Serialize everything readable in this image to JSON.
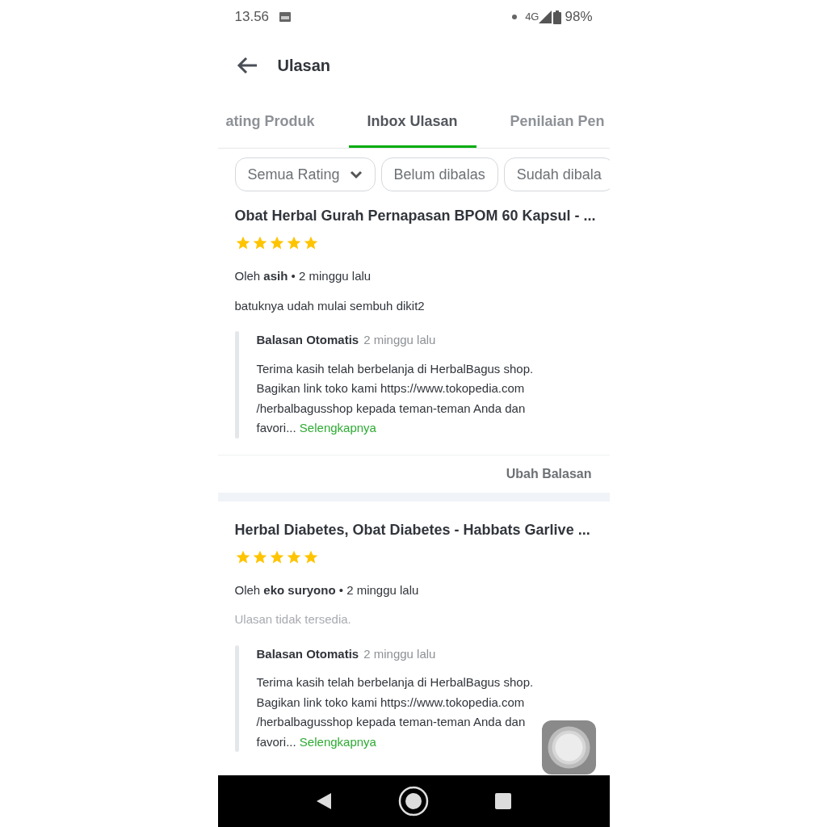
{
  "status_bar": {
    "time": "13.56",
    "network": "4G",
    "battery": "98%"
  },
  "header": {
    "title": "Ulasan"
  },
  "tabs": [
    {
      "label": "ating Produk",
      "selected": false
    },
    {
      "label": "Inbox Ulasan",
      "selected": true
    },
    {
      "label": "Penilaian Pen",
      "selected": false
    }
  ],
  "filters": [
    {
      "label": "Semua Rating",
      "dropdown": true
    },
    {
      "label": "Belum dibalas",
      "dropdown": false
    },
    {
      "label": "Sudah dibala",
      "dropdown": false
    }
  ],
  "reviews": [
    {
      "product": "Obat Herbal Gurah Pernapasan BPOM 60 Kapsul - ...",
      "stars": 5,
      "by": "Oleh",
      "reviewer": "asih",
      "separator": "•",
      "time": "2 minggu lalu",
      "text": "batuknya udah mulai sembuh dikit2",
      "available": true,
      "reply": {
        "author": "Balasan Otomatis",
        "time": "2 minggu lalu",
        "lines": [
          "Terima kasih telah berbelanja di HerbalBagus shop.",
          "Bagikan link toko kami https://www.tokopedia.com",
          "/herbalbagusshop kepada teman-teman Anda dan",
          "favori..."
        ],
        "more": "Selengkapnya"
      },
      "action": "Ubah Balasan"
    },
    {
      "product": "Herbal Diabetes, Obat Diabetes - Habbats Garlive ...",
      "stars": 5,
      "by": "Oleh",
      "reviewer": "eko suryono",
      "separator": "•",
      "time": "2 minggu lalu",
      "text": "Ulasan tidak tersedia.",
      "available": false,
      "reply": {
        "author": "Balasan Otomatis",
        "time": "2 minggu lalu",
        "lines": [
          "Terima kasih telah berbelanja di HerbalBagus shop.",
          "Bagikan link toko kami https://www.tokopedia.com",
          "/herbalbagusshop kepada teman-teman Anda dan",
          "favori..."
        ],
        "more": "Selengkapnya"
      }
    }
  ]
}
